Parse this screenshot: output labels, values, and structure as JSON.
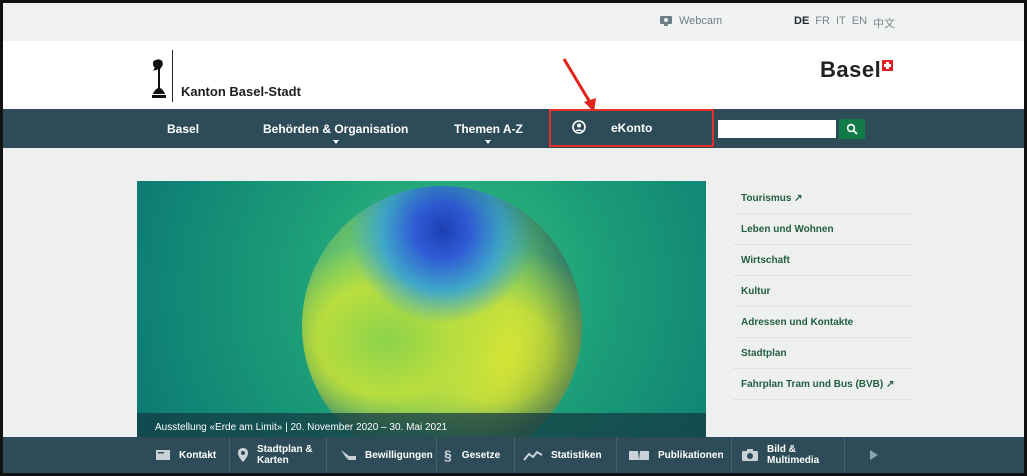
{
  "utility": {
    "webcam_label": "Webcam",
    "languages": [
      "DE",
      "FR",
      "IT",
      "EN",
      "中文"
    ],
    "active_language": "DE"
  },
  "header": {
    "site_name": "Kanton Basel-Stadt",
    "brand_word": "Basel"
  },
  "nav": {
    "items": [
      "Basel",
      "Behörden & Organisation",
      "Themen A-Z",
      "eKonto"
    ],
    "search_placeholder": ""
  },
  "hero": {
    "caption": "Ausstellung «Erde am Limit» | 20. November 2020 – 30. Mai 2021"
  },
  "sidebar": {
    "items": [
      "Tourismus ↗",
      "Leben und Wohnen",
      "Wirtschaft",
      "Kultur",
      "Adressen und Kontakte",
      "Stadtplan",
      "Fahrplan Tram und Bus (BVB) ↗"
    ]
  },
  "footer": {
    "items": [
      "Kontakt",
      "Stadtplan & Karten",
      "Bewilligungen",
      "Gesetze",
      "Statistiken",
      "Publikationen",
      "Bild & Multimedia"
    ],
    "stadtplan_line1": "Stadtplan &",
    "stadtplan_line2": "Karten",
    "bild_line1": "Bild &",
    "bild_line2": "Multimedia"
  },
  "colors": {
    "nav_bg": "#2d4c58",
    "accent_green": "#127a46",
    "highlight_red": "#e3302a",
    "link_green": "#235e3f"
  }
}
